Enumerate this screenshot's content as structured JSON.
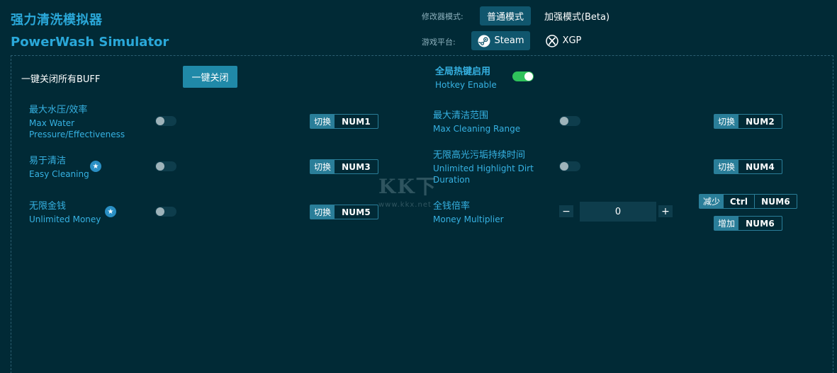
{
  "app": {
    "title_cn": "强力清洗模拟器",
    "title_en": "PowerWash Simulator"
  },
  "header": {
    "mode_label": "修改器模式:",
    "modes": [
      "普通模式",
      "加强模式(Beta)"
    ],
    "platform_label": "游戏平台:",
    "platforms": [
      "Steam",
      "XGP"
    ]
  },
  "controls": {
    "close_all_label": "一键关闭所有BUFF",
    "close_all_button": "一键关闭",
    "hotkey_cn": "全局热键启用",
    "hotkey_en": "Hotkey Enable",
    "hotkey_enabled": true
  },
  "cheats": {
    "c1": {
      "cn": "最大水压/效率",
      "en1": "Max Water",
      "en2": "Pressure/Effectiveness",
      "enabled": false,
      "hk_action": "切换",
      "hk_key": "NUM1"
    },
    "c2": {
      "cn": "最大清洁范围",
      "en": "Max Cleaning Range",
      "enabled": false,
      "hk_action": "切换",
      "hk_key": "NUM2"
    },
    "c3": {
      "cn": "易于清洁",
      "en": "Easy Cleaning",
      "enabled": false,
      "hk_action": "切换",
      "hk_key": "NUM3"
    },
    "c4": {
      "cn": "无限高光污垢持续时间",
      "en1": "Unlimited Highlight Dirt",
      "en2": "Duration",
      "enabled": false,
      "hk_action": "切换",
      "hk_key": "NUM4"
    },
    "c5": {
      "cn": "无限金钱",
      "en": "Unlimited Money",
      "enabled": false,
      "hk_action": "切换",
      "hk_key": "NUM5"
    },
    "c6": {
      "cn": "全钱倍率",
      "en": "Money Multiplier",
      "value": "0",
      "minus": "−",
      "plus": "+",
      "dec_action": "减少",
      "dec_mod": "Ctrl",
      "dec_key": "NUM6",
      "inc_action": "增加",
      "inc_key": "NUM6"
    }
  },
  "watermark": {
    "logo": "KK下",
    "site": "www.kkx.net"
  },
  "colors": {
    "background": "#012a36",
    "accent": "#2aa8d9",
    "button": "#2089a8",
    "toggle_on": "#2fc25b"
  },
  "icons": {
    "steam": "steam-icon",
    "xbox": "xbox-icon",
    "star": "star-icon"
  }
}
